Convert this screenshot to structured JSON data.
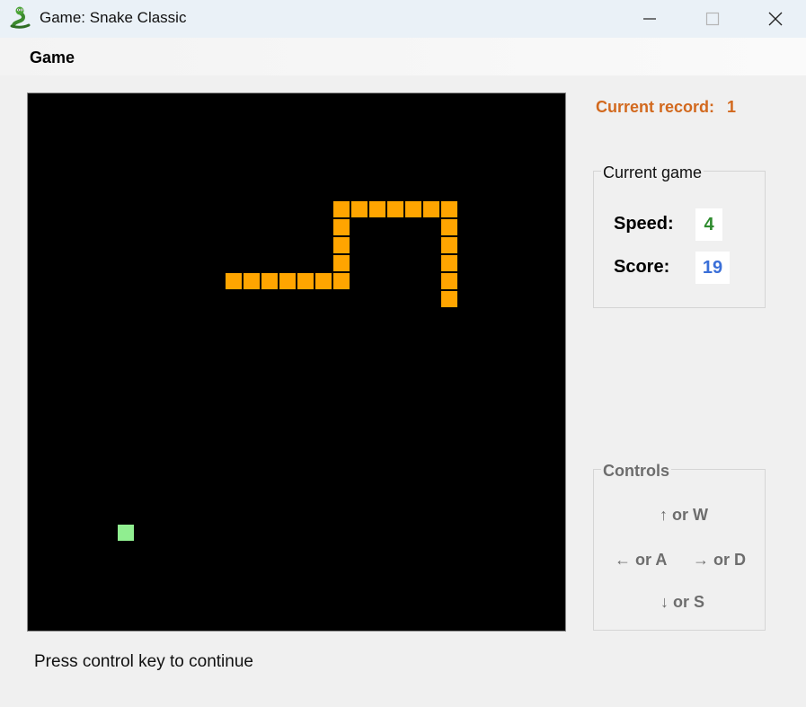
{
  "window": {
    "title": "Game: Snake Classic",
    "icon": "snake-icon"
  },
  "title_buttons": {
    "minimize": "minimize-icon",
    "maximize": "maximize-icon",
    "close": "close-icon"
  },
  "menu": {
    "items": [
      {
        "label": "Game"
      }
    ]
  },
  "board": {
    "grid_cells": 30,
    "background": "#000000",
    "snake_color": "#ffa500",
    "food_color": "#90ee90",
    "snake": [
      [
        11,
        10
      ],
      [
        12,
        10
      ],
      [
        13,
        10
      ],
      [
        14,
        10
      ],
      [
        15,
        10
      ],
      [
        16,
        10
      ],
      [
        17,
        10
      ],
      [
        17,
        9
      ],
      [
        17,
        8
      ],
      [
        17,
        7
      ],
      [
        17,
        6
      ],
      [
        18,
        6
      ],
      [
        19,
        6
      ],
      [
        20,
        6
      ],
      [
        21,
        6
      ],
      [
        22,
        6
      ],
      [
        23,
        6
      ],
      [
        23,
        7
      ],
      [
        23,
        8
      ],
      [
        23,
        9
      ],
      [
        23,
        10
      ],
      [
        23,
        11
      ]
    ],
    "food": [
      5,
      24
    ]
  },
  "record": {
    "label": "Current record:",
    "value": "1",
    "color": "#d2691e"
  },
  "current_game": {
    "legend": "Current game",
    "speed_label": "Speed:",
    "speed_value": "4",
    "score_label": "Score:",
    "score_value": "19"
  },
  "controls": {
    "legend": "Controls",
    "up": "↑ or W",
    "left": "← or A",
    "right": "→ or D",
    "down": "↓ or S"
  },
  "status": {
    "text": "Press control key to continue"
  }
}
